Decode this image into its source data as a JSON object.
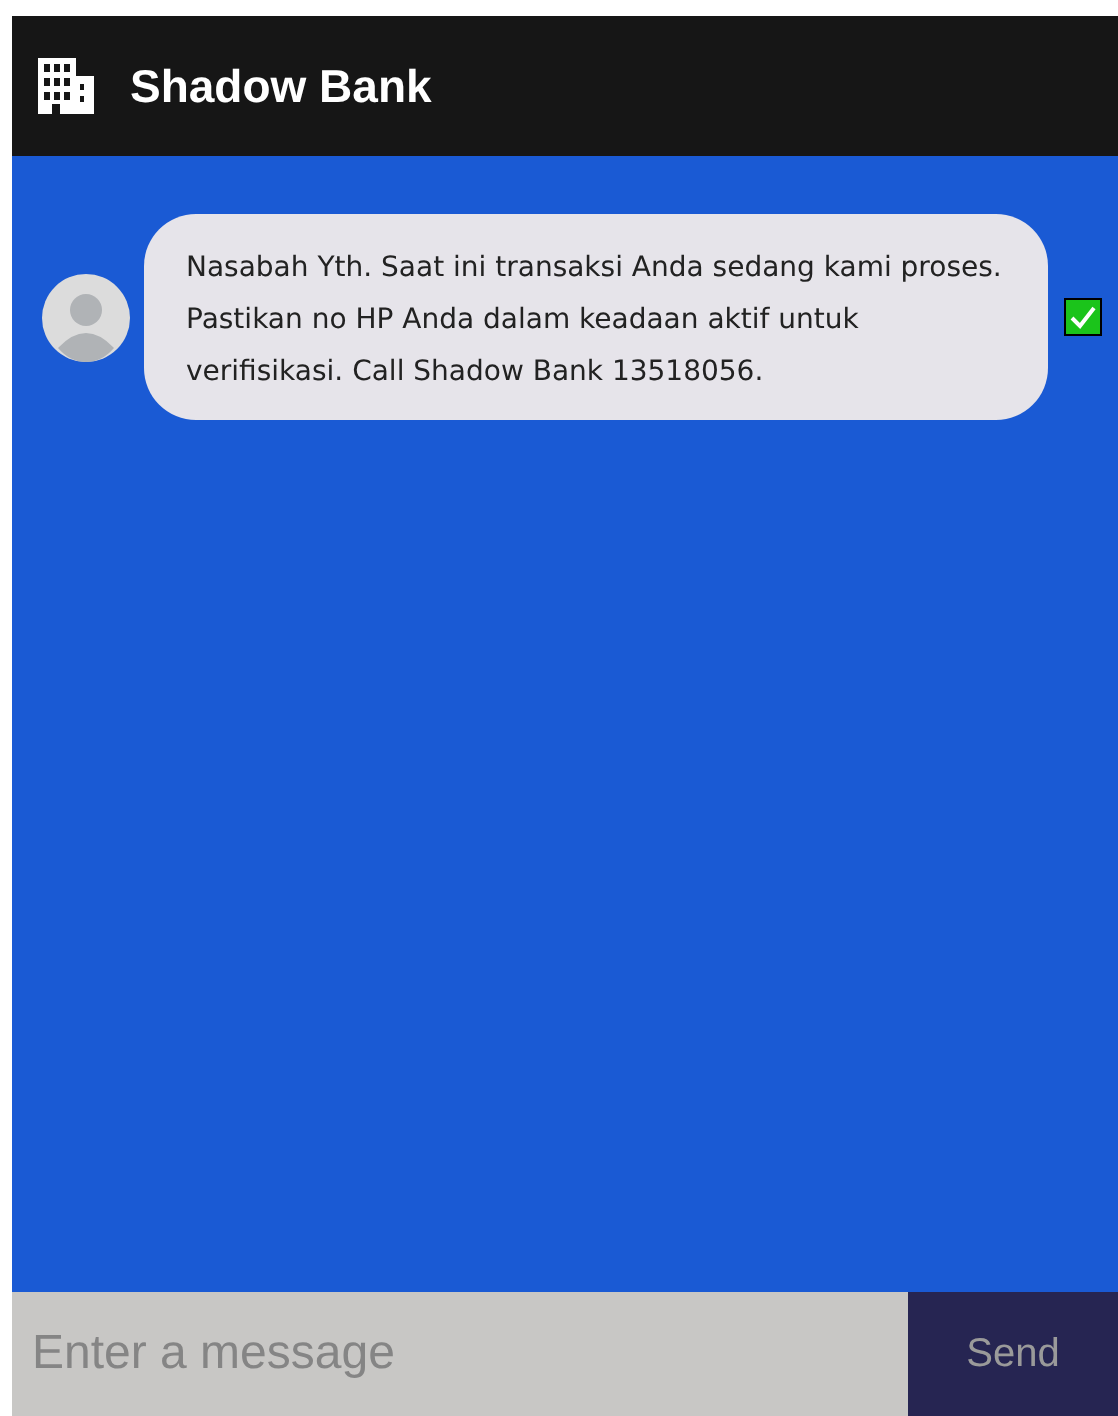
{
  "header": {
    "title": "Shadow Bank"
  },
  "messages": [
    {
      "text": "Nasabah Yth. Saat ini transaksi Anda sedang kami proses. Pastikan no HP Anda dalam keadaan aktif untuk verifisikasi. Call Shadow Bank 13518056.",
      "delivered": true
    }
  ],
  "composer": {
    "placeholder": "Enter a message",
    "button": "Send"
  }
}
